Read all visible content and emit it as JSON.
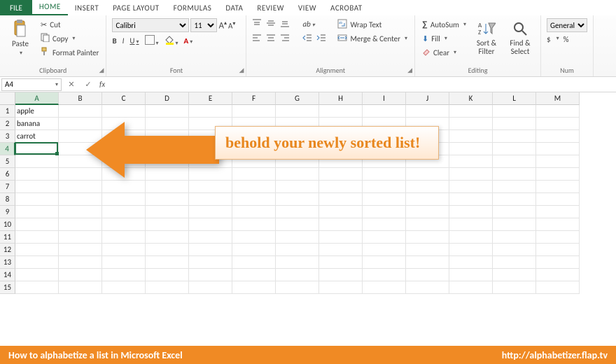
{
  "tabs": {
    "file": "FILE",
    "items": [
      "HOME",
      "INSERT",
      "PAGE LAYOUT",
      "FORMULAS",
      "DATA",
      "REVIEW",
      "VIEW",
      "ACROBAT"
    ],
    "active": "HOME"
  },
  "ribbon": {
    "clipboard": {
      "paste": "Paste",
      "cut": "Cut",
      "copy": "Copy",
      "fmt": "Format Painter",
      "label": "Clipboard"
    },
    "font": {
      "name": "Calibri",
      "size": "11",
      "bold": "B",
      "italic": "I",
      "underline": "U",
      "increase": "A",
      "decrease": "A",
      "label": "Font"
    },
    "alignment": {
      "wrap": "Wrap Text",
      "merge": "Merge & Center",
      "label": "Alignment"
    },
    "editing": {
      "autosum": "AutoSum",
      "fill": "Fill",
      "clear": "Clear",
      "sort": "Sort & Filter",
      "find": "Find & Select",
      "label": "Editing"
    },
    "number": {
      "general": "General",
      "currency": "$",
      "percent": "%",
      "label": "Num"
    }
  },
  "formula_bar": {
    "namebox": "A4",
    "fx": "fx",
    "value": ""
  },
  "grid": {
    "columns": [
      "A",
      "B",
      "C",
      "D",
      "E",
      "F",
      "G",
      "H",
      "I",
      "J",
      "K",
      "L",
      "M"
    ],
    "rows": 15,
    "active_col": "A",
    "active_row": 4,
    "data": {
      "A1": "apple",
      "A2": "banana",
      "A3": "carrot"
    }
  },
  "annotation": {
    "text": "behold your newly sorted list!"
  },
  "footer": {
    "left": "How to alphabetize a list in Microsoft Excel",
    "right": "http://alphabetizer.flap.tv"
  }
}
